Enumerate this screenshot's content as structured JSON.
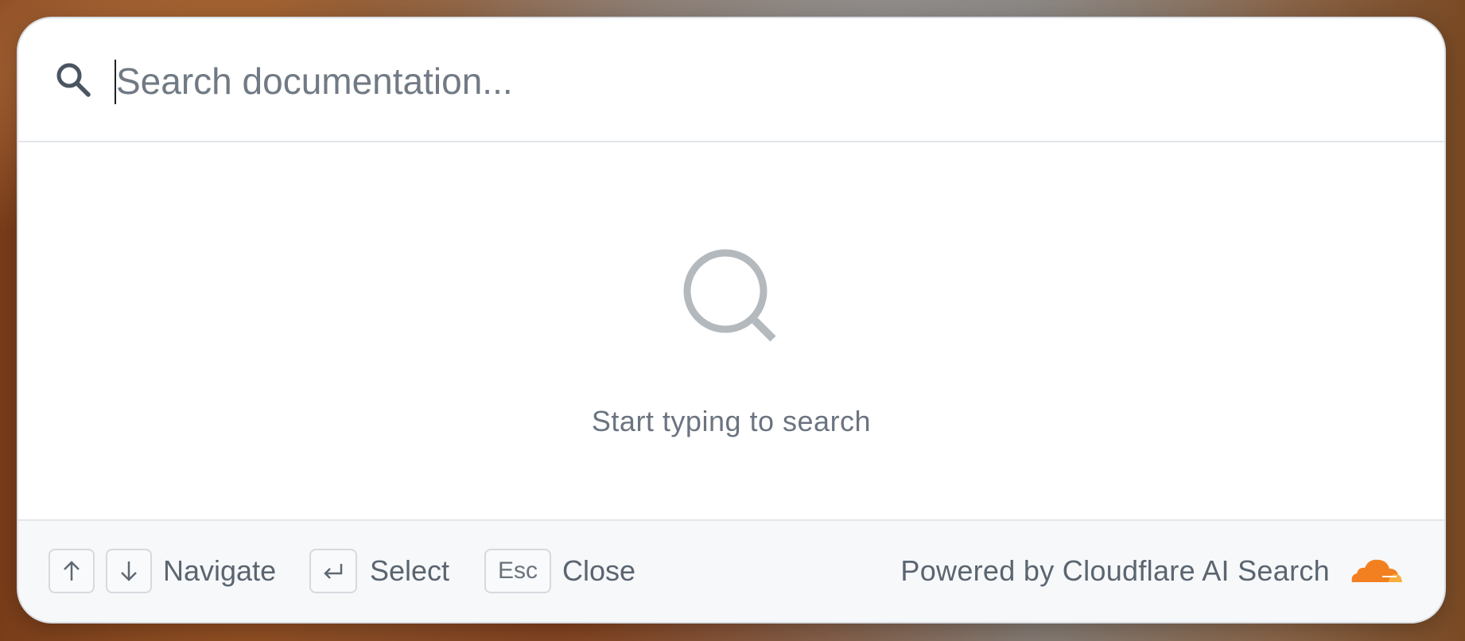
{
  "search": {
    "placeholder": "Search documentation...",
    "value": "",
    "icon": "search-icon"
  },
  "empty_state": {
    "icon": "search-icon",
    "message": "Start typing to search"
  },
  "footer": {
    "hints": [
      {
        "keys": [
          "↑",
          "↓"
        ],
        "key_icons": [
          "arrow-up-icon",
          "arrow-down-icon"
        ],
        "label": "Navigate"
      },
      {
        "keys": [
          "↵"
        ],
        "key_icons": [
          "enter-icon"
        ],
        "label": "Select"
      },
      {
        "keys": [
          "Esc"
        ],
        "label": "Close"
      }
    ],
    "powered_by": "Powered by Cloudflare AI Search",
    "brand_icon": "cloudflare-icon"
  },
  "colors": {
    "brand_orange": "#F38020",
    "brand_orange_light": "#FAAE40",
    "icon_gray": "#b4b9be",
    "text_muted": "#5b6570"
  }
}
